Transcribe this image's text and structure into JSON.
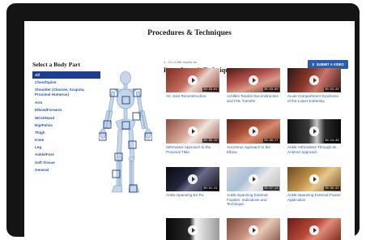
{
  "page": {
    "title": "Procedures & Techniques"
  },
  "sidebar": {
    "heading": "Select a Body Part",
    "items": [
      {
        "label": "All",
        "active": true
      },
      {
        "label": "Chest/Spine"
      },
      {
        "label": "Shoulder (Clavicle, Scapula, Proximal Humerus)"
      },
      {
        "label": "Arm"
      },
      {
        "label": "Elbow/Forearm"
      },
      {
        "label": "Wrist/Hand"
      },
      {
        "label": "Hip/Pelvis"
      },
      {
        "label": "Thigh"
      },
      {
        "label": "Knee"
      },
      {
        "label": "Leg"
      },
      {
        "label": "Ankle/Foot"
      },
      {
        "label": "Soft Tissue"
      },
      {
        "label": "General"
      }
    ]
  },
  "results": {
    "count_text": "1 - 13 of 286 results for",
    "title": "Procedures & Techniques",
    "submit_label": "SUBMIT A VIDEO"
  },
  "videos": [
    {
      "title": "AC Joint Reconstruction",
      "duration": "00:03:01"
    },
    {
      "title": "Achilles Tendon Reconstruction and FHL Transfer",
      "duration": "00:03:00"
    },
    {
      "title": "Acute Compartment Syndrome of the Lower Extremity",
      "duration": "00:03:26"
    },
    {
      "title": "Alternative Approach to the Proximal Tibia",
      "duration": "00:05:19"
    },
    {
      "title": "Anconeus Approach to the Elbow",
      "duration": "00:06:17"
    },
    {
      "title": "Ankle Arthrodesis Through an Anterior Approach",
      "duration": "00:14:46"
    },
    {
      "title": "Ankle-Spanning Ex-Fix",
      "duration": "00:01:22"
    },
    {
      "title": "Ankle-Spanning External Fixation: Indications and Technique",
      "duration": "00:07:13"
    },
    {
      "title": "Ankle-Spanning External Fixator Application",
      "duration": "00:09:34"
    },
    {
      "title": "",
      "duration": ""
    },
    {
      "title": "",
      "duration": ""
    },
    {
      "title": "",
      "duration": ""
    }
  ]
}
